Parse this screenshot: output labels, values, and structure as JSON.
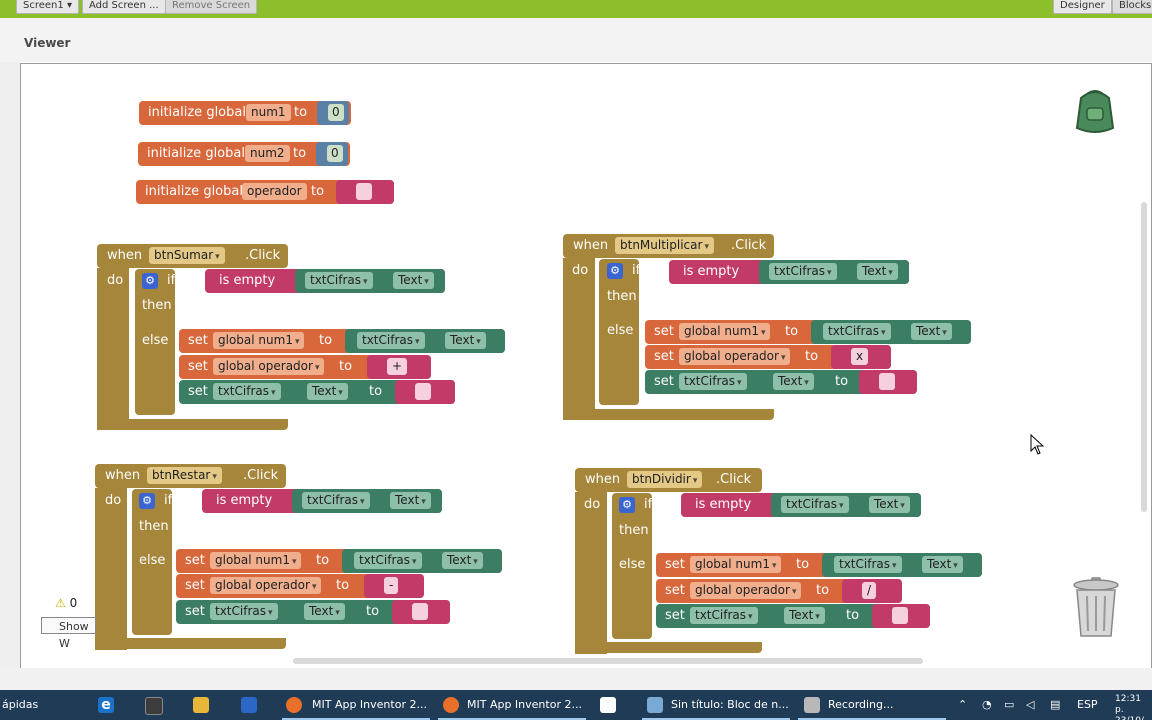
{
  "topbar": {
    "screen_select": "Screen1",
    "add_screen": "Add Screen ...",
    "remove_screen": "Remove Screen",
    "designer": "Designer",
    "blocks": "Blocks"
  },
  "viewer": {
    "title": "Viewer"
  },
  "kw": {
    "initialize_global": "initialize global",
    "to": "to",
    "when": "when",
    "do": "do",
    "if": "if",
    "then": "then",
    "else": "else",
    "is_empty": "is empty",
    "set": "set",
    "click": ".Click",
    "text": "Text",
    "dot": ".",
    "quote": "\" \"",
    "dropdown": "▾"
  },
  "globals": [
    {
      "name": "num1",
      "value": "0"
    },
    {
      "name": "num2",
      "value": "0"
    },
    {
      "name": "operador",
      "value": ""
    }
  ],
  "handlers": [
    {
      "button": "btnSumar",
      "component": "txtCifras",
      "var1": "global num1",
      "var2": "global operador",
      "op": "+"
    },
    {
      "button": "btnMultiplicar",
      "component": "txtCifras",
      "var1": "global num1",
      "var2": "global operador",
      "op": "x"
    },
    {
      "button": "btnRestar",
      "component": "txtCifras",
      "var1": "global num1",
      "var2": "global operador",
      "op": "-"
    },
    {
      "button": "btnDividir",
      "component": "txtCifras",
      "var1": "global num1",
      "var2": "global operador",
      "op": "/"
    }
  ],
  "warnings": {
    "count": "0",
    "show_label": "Show W"
  },
  "taskbar": {
    "start_text": "ápidas",
    "items": [
      "MIT App Inventor 2...",
      "MIT App Inventor 2...",
      "Sin título: Bloc de n...",
      "Recording..."
    ],
    "language": "ESP",
    "time": "12:31 p.",
    "date": "23/10/"
  },
  "colors": {
    "topbar": "#8cbf2b",
    "event_block": "#a6863a",
    "variable_block": "#d8683c",
    "text_block": "#c23a68",
    "component_block": "#3c7e63",
    "number_block": "#5b80a5",
    "taskbar": "#203b55"
  }
}
